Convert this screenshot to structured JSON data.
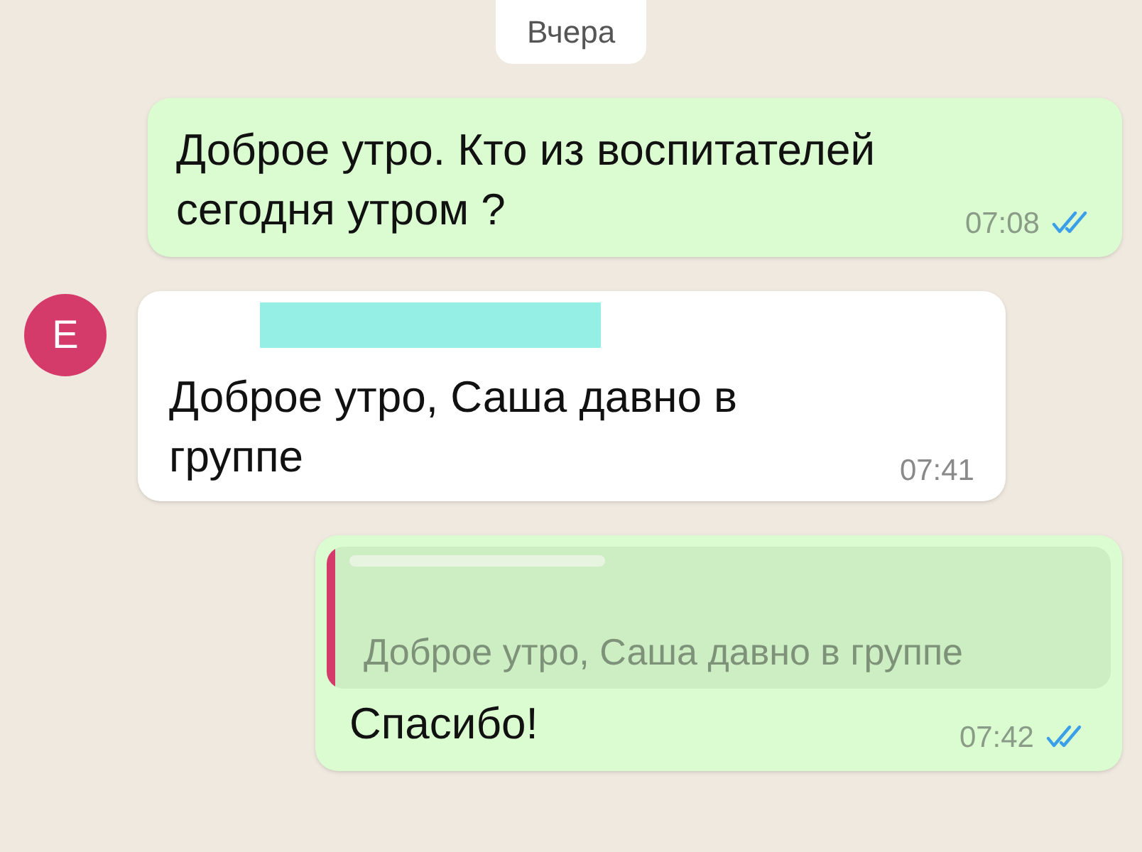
{
  "date_chip": "Вчера",
  "messages": [
    {
      "kind": "outgoing",
      "text": "Доброе утро. Кто из воспитателей сегодня утром ?",
      "time": "07:08",
      "read": true
    },
    {
      "kind": "incoming",
      "avatar": {
        "letter": "E",
        "color": "#d43b6b"
      },
      "text": "Доброе утро, Саша давно в группе",
      "time": "07:41"
    },
    {
      "kind": "outgoing",
      "quote": {
        "text": "Доброе утро, Саша давно в группе",
        "color": "#d43b6b"
      },
      "text": "Спасибо!",
      "time": "07:42",
      "read": true
    }
  ]
}
